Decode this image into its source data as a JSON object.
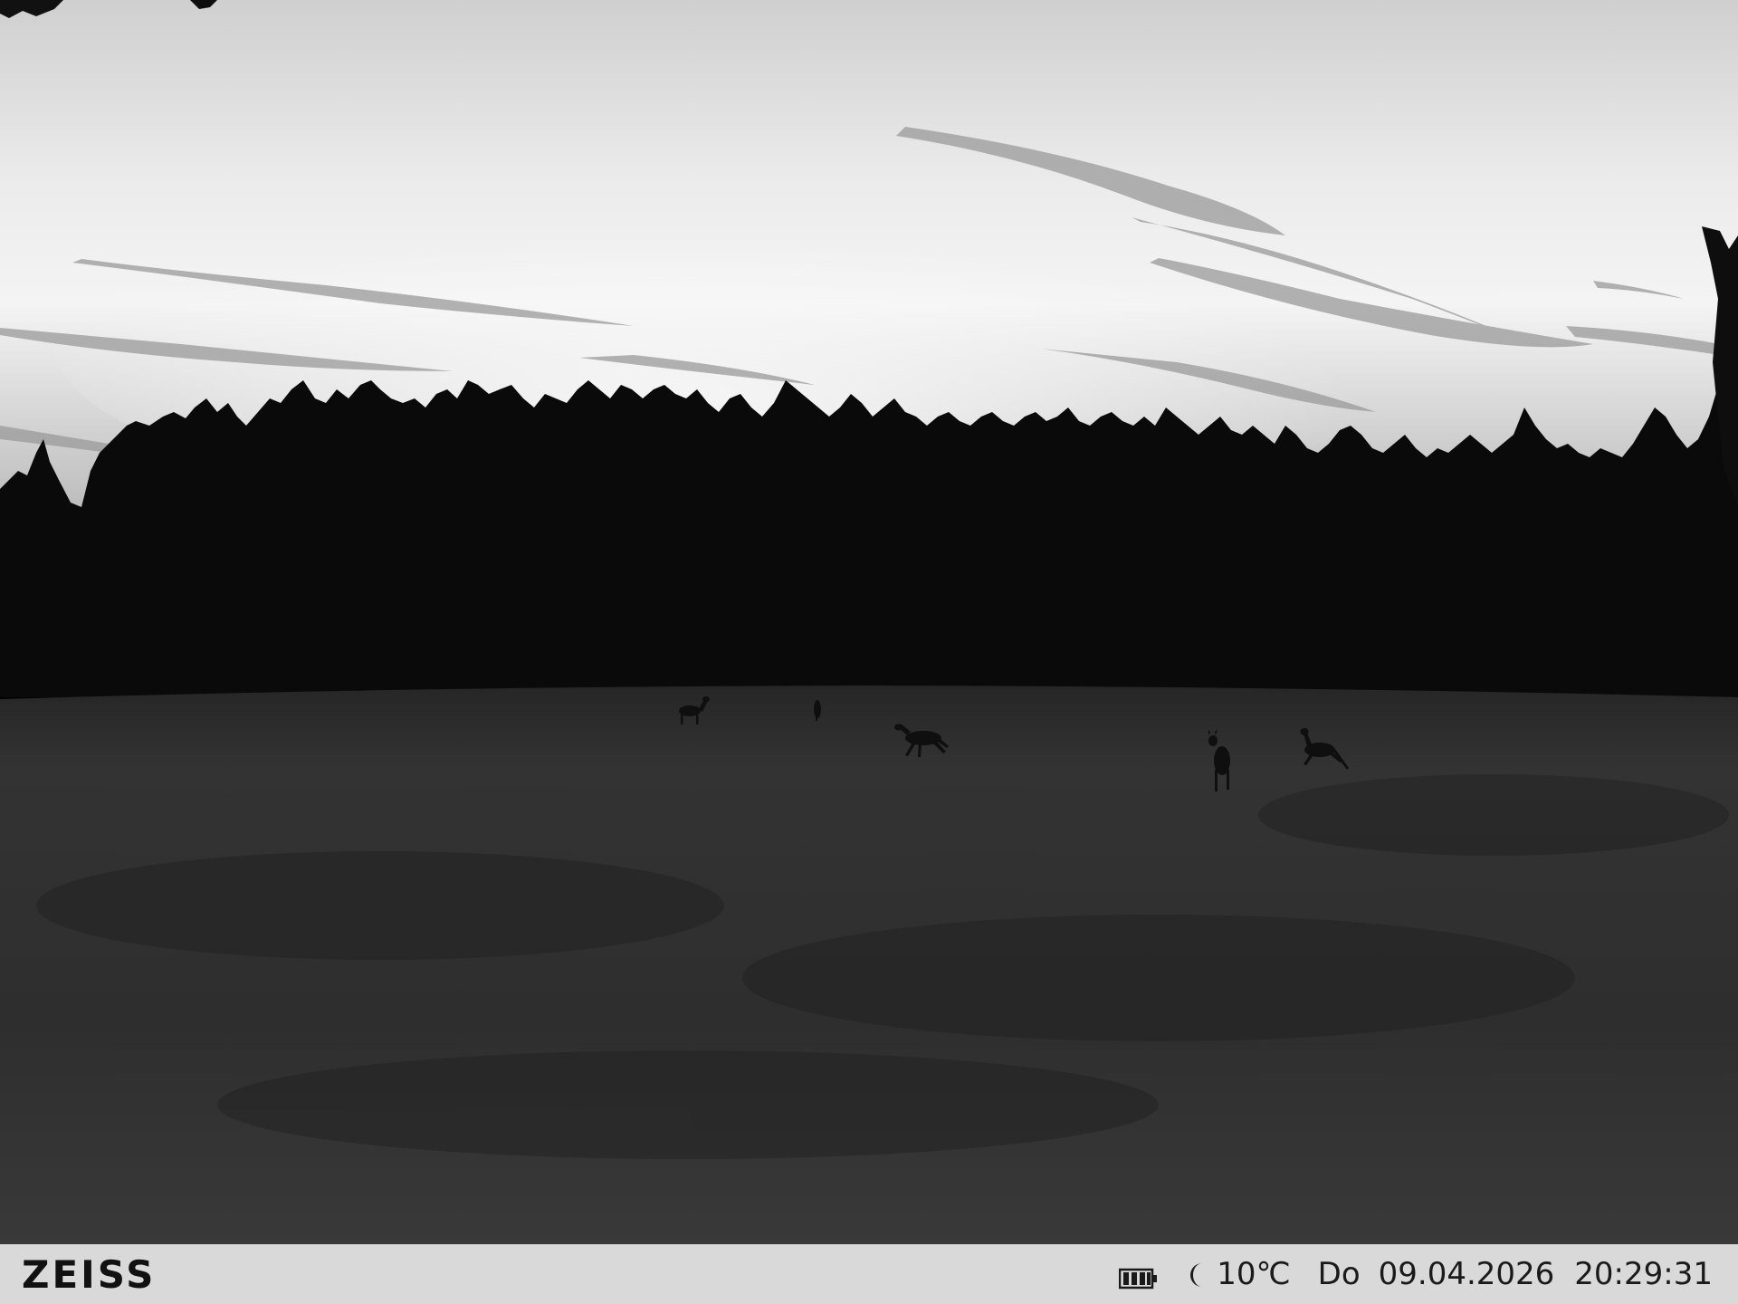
{
  "camera": {
    "brand": "ZEISS",
    "icons": {
      "battery": "battery-full-icon",
      "moon": "moon-night-icon"
    },
    "temperature": "10℃",
    "weekday": "Do",
    "date": "09.04.2026",
    "time": "20:29:31"
  },
  "scene": {
    "description_colors": {
      "sky": "#e8e8e8",
      "forest": "#0b0b0b",
      "meadow": "#2f2f2f",
      "infobar": "#d9d9d9"
    },
    "deer_count": 5
  }
}
